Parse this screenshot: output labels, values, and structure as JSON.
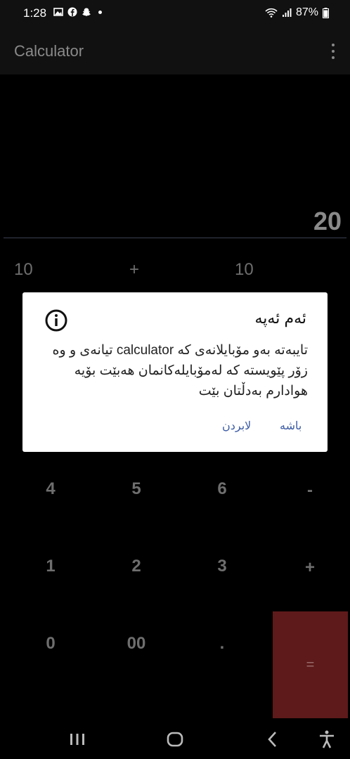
{
  "status": {
    "time": "1:28",
    "battery": "87%",
    "icons": [
      "gallery-icon",
      "facebook-icon",
      "snapchat-icon",
      "notification-dot",
      "wifi-icon",
      "signal-icon",
      "battery-icon"
    ]
  },
  "app": {
    "title": "Calculator"
  },
  "display": {
    "result": "20",
    "expression": {
      "left": "10",
      "op": "+",
      "right": "10"
    }
  },
  "keypad": {
    "row4": [
      "4",
      "5",
      "6",
      "-"
    ],
    "row5": [
      "1",
      "2",
      "3",
      "+"
    ],
    "row6": [
      "0",
      "00",
      ".",
      "="
    ]
  },
  "dialog": {
    "title": "ئەم ئەپە",
    "body": "تایبەتە بەو مۆبایلانەی کە calculator تیانەی و وە زۆر پێویستە کە لەمۆبایلەکانمان هەبێت بۆیە هوادارم بەدڵتان بێت",
    "ok": "باشە",
    "dismiss": "لابردن"
  },
  "colors": {
    "accent": "#3b5ba5",
    "equals": "#5e1a1a"
  }
}
